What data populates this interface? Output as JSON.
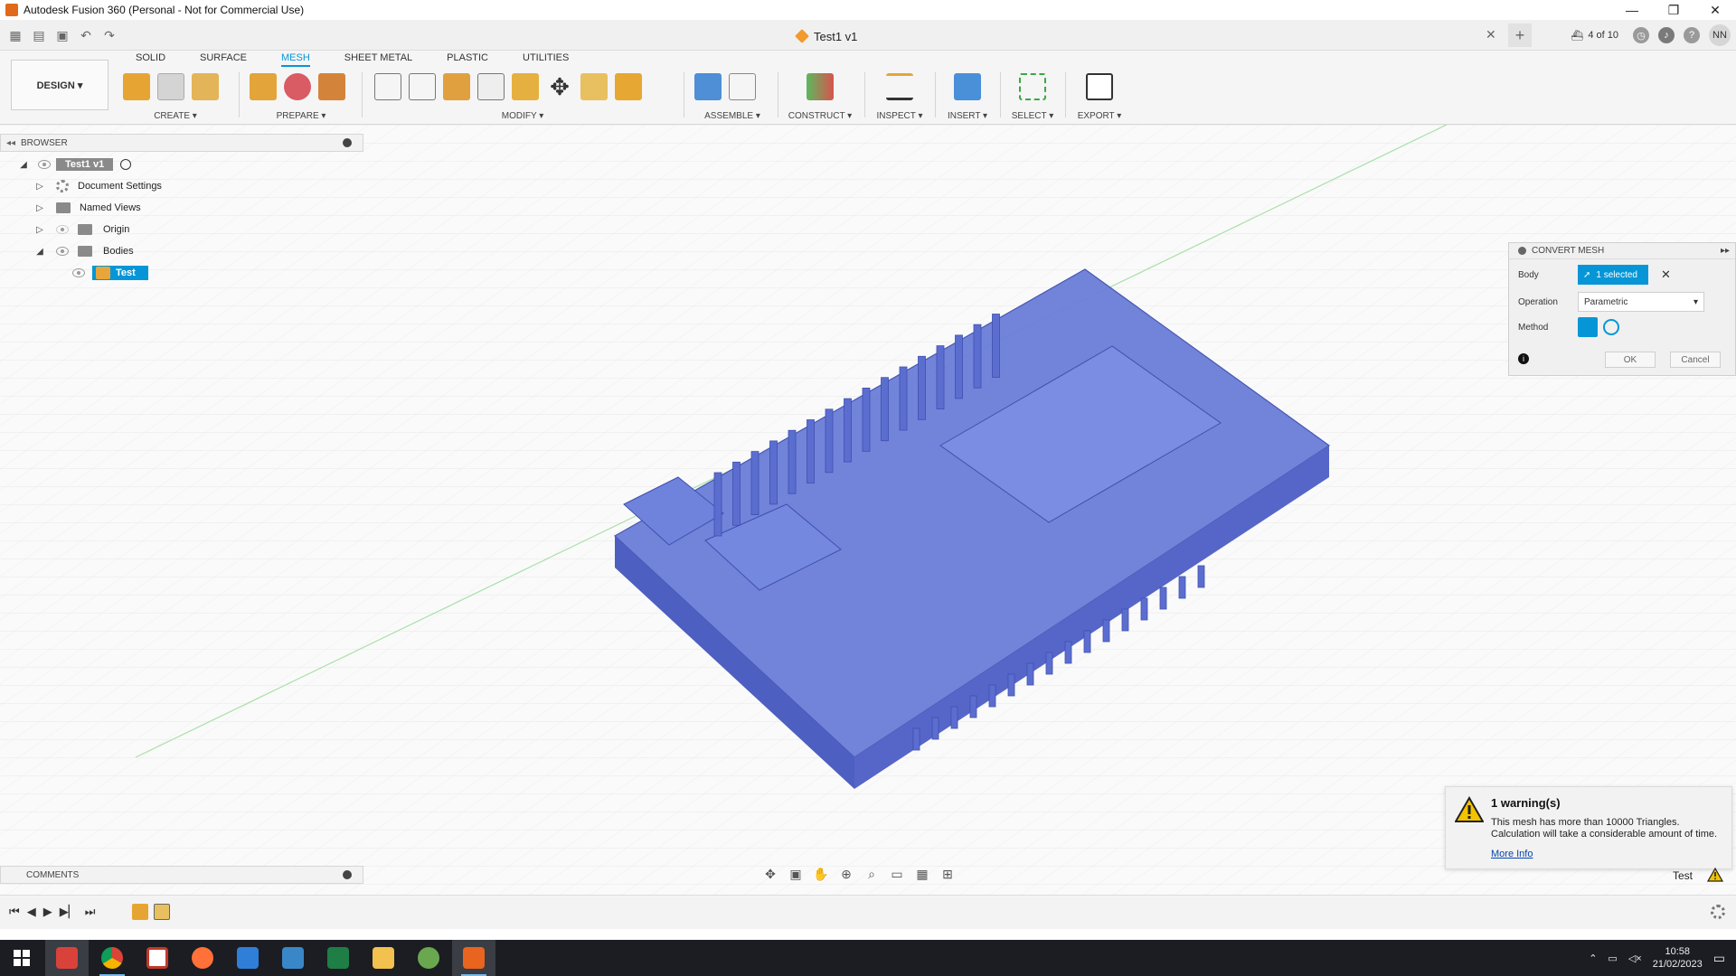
{
  "window": {
    "title": "Autodesk Fusion 360 (Personal - Not for Commercial Use)",
    "controls": {
      "minimize": "—",
      "restore": "❐",
      "close": "✕"
    }
  },
  "appbar": {
    "document_tab": "Test1 v1",
    "tab_close": "✕",
    "add_tab": "+",
    "jobs": "4 of 10",
    "user_initials": "NN"
  },
  "ribbon": {
    "workspace_tabs": [
      "SOLID",
      "SURFACE",
      "MESH",
      "SHEET METAL",
      "PLASTIC",
      "UTILITIES"
    ],
    "active_tab": "MESH",
    "workspace_switcher": "DESIGN ▾",
    "groups": {
      "create": "CREATE ▾",
      "prepare": "PREPARE ▾",
      "modify": "MODIFY ▾",
      "assemble": "ASSEMBLE ▾",
      "construct": "CONSTRUCT ▾",
      "inspect": "INSPECT ▾",
      "insert": "INSERT ▾",
      "select": "SELECT ▾",
      "export": "EXPORT ▾"
    }
  },
  "browser": {
    "title": "BROWSER",
    "root": "Test1 v1",
    "items": [
      "Document Settings",
      "Named Views",
      "Origin",
      "Bodies"
    ],
    "body": "Test"
  },
  "dialog": {
    "title": "CONVERT MESH",
    "body_label": "Body",
    "body_value": "1 selected",
    "operation_label": "Operation",
    "operation_value": "Parametric",
    "method_label": "Method",
    "ok": "OK",
    "cancel": "Cancel"
  },
  "toast": {
    "heading": "1 warning(s)",
    "message": "This mesh has more than 10000 Triangles. Calculation will take a considerable amount of time.",
    "link": "More Info"
  },
  "comments": {
    "title": "COMMENTS"
  },
  "status": {
    "body_name": "Test"
  },
  "taskbar": {
    "time": "10:58",
    "date": "21/02/2023"
  },
  "colors": {
    "accent": "#0696d7",
    "mesh_body": "#5a6fd0",
    "warning": "#f3c200"
  }
}
